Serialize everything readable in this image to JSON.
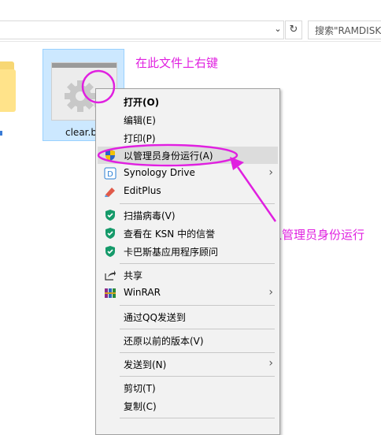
{
  "explorer": {
    "search_placeholder": "搜索\"RAMDISK",
    "file_name": "clear.b"
  },
  "annotations": {
    "hint_top": "在此文件上右键",
    "hint_right": "点以管理员身份运行",
    "color": "#e020e0"
  },
  "menu": {
    "items": [
      {
        "label": "打开(O)",
        "icon": ""
      },
      {
        "label": "编辑(E)",
        "icon": ""
      },
      {
        "label": "打印(P)",
        "icon": ""
      },
      {
        "label": "以管理员身份运行(A)",
        "icon": "uac-shield-icon"
      },
      {
        "label": "Synology Drive",
        "icon": "synology-drive-icon"
      },
      {
        "label": "EditPlus",
        "icon": "editplus-icon"
      },
      {
        "label": "扫描病毒(V)",
        "icon": "kaspersky-shield-icon"
      },
      {
        "label": "查看在 KSN 中的信誉",
        "icon": "kaspersky-shield-icon"
      },
      {
        "label": "卡巴斯基应用程序顾问",
        "icon": "kaspersky-shield-icon"
      },
      {
        "label": "共享",
        "icon": "share-icon"
      },
      {
        "label": "WinRAR",
        "icon": "winrar-icon"
      },
      {
        "label": "通过QQ发送到",
        "icon": ""
      },
      {
        "label": "还原以前的版本(V)",
        "icon": ""
      },
      {
        "label": "发送到(N)",
        "icon": ""
      },
      {
        "label": "剪切(T)",
        "icon": ""
      },
      {
        "label": "复制(C)",
        "icon": ""
      }
    ]
  }
}
